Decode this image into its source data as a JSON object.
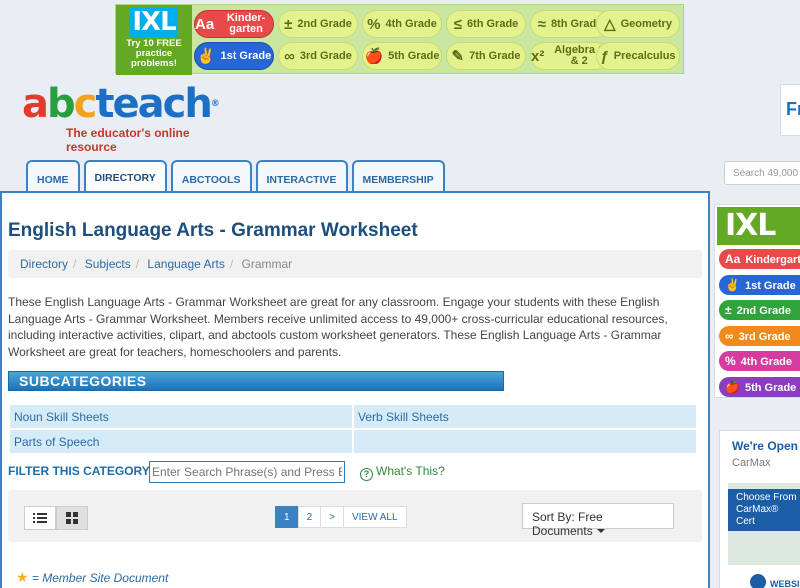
{
  "ad_banner": {
    "cta": "Try 10 FREE practice problems!",
    "grades": [
      {
        "glyph": "Aa",
        "label": "Kinder-garten",
        "style": "kg"
      },
      {
        "glyph": "±",
        "label": "2nd Grade",
        "style": ""
      },
      {
        "glyph": "%",
        "label": "4th Grade",
        "style": ""
      },
      {
        "glyph": "≤",
        "label": "6th Grade",
        "style": ""
      },
      {
        "glyph": "≈",
        "label": "8th Grade",
        "style": ""
      },
      {
        "glyph": "△",
        "label": "Geometry",
        "style": ""
      },
      {
        "glyph": "✌",
        "label": "1st Grade",
        "style": "g1"
      },
      {
        "glyph": "∞",
        "label": "3rd Grade",
        "style": ""
      },
      {
        "glyph": "🍎",
        "label": "5th Grade",
        "style": ""
      },
      {
        "glyph": "✎",
        "label": "7th Grade",
        "style": ""
      },
      {
        "glyph": "x²",
        "label": "Algebra 1 & 2",
        "style": ""
      },
      {
        "glyph": "ƒ",
        "label": "Precalculus",
        "style": ""
      }
    ]
  },
  "logo": {
    "tagline": "The educator's online resource"
  },
  "right_promo": {
    "text": "Fr"
  },
  "nav": {
    "tabs": [
      {
        "label": "HOME",
        "active": false
      },
      {
        "label": "DIRECTORY",
        "active": true
      },
      {
        "label": "ABCTOOLS",
        "active": false
      },
      {
        "label": "INTERACTIVE",
        "active": false
      },
      {
        "label": "MEMBERSHIP",
        "active": false
      }
    ],
    "search_placeholder": "Search 49,000 d"
  },
  "main": {
    "title": "English Language Arts - Grammar Worksheet",
    "breadcrumb": [
      "Directory",
      "Subjects",
      "Language Arts",
      "Grammar"
    ],
    "description": "These English Language Arts - Grammar Worksheet are great for any classroom. Engage your students with these English Language Arts - Grammar Worksheet. Members receive unlimited access to 49,000+ cross-curricular educational resources, including interactive activities, clipart, and abctools custom worksheet generators. These English Language Arts - Grammar Worksheet are great for teachers, homeschoolers and parents.",
    "subcategories_heading": "SUBCATEGORIES",
    "subcategories": [
      [
        "Noun Skill Sheets",
        "Verb Skill Sheets"
      ],
      [
        "Parts of Speech",
        ""
      ]
    ],
    "filter": {
      "label": "FILTER THIS CATEGORY:",
      "placeholder": "Enter Search Phrase(s) and Press Enter",
      "help": "What's This?"
    },
    "pagination": [
      "1",
      "2",
      ">",
      "VIEW ALL"
    ],
    "sort_label": "Sort By: Free Documents",
    "legend": "= Member Site Document"
  },
  "sidebar": {
    "ixl_text": "IXL",
    "grades": [
      {
        "glyph": "Aa",
        "label": "Kindergarten",
        "color": "#e84a4a"
      },
      {
        "glyph": "✌",
        "label": "1st Grade",
        "color": "#2766d6"
      },
      {
        "glyph": "±",
        "label": "2nd Grade",
        "color": "#2fa43a"
      },
      {
        "glyph": "∞",
        "label": "3rd Grade",
        "color": "#f08a1c"
      },
      {
        "glyph": "%",
        "label": "4th Grade",
        "color": "#d63b9e"
      },
      {
        "glyph": "🍎",
        "label": "5th Grade",
        "color": "#8a3dbd"
      }
    ],
    "carmax": {
      "heading": "We're Open a",
      "sub": "CarMax",
      "map_label": "Choose From CarMax® Cert",
      "web": "WEBSI"
    }
  }
}
